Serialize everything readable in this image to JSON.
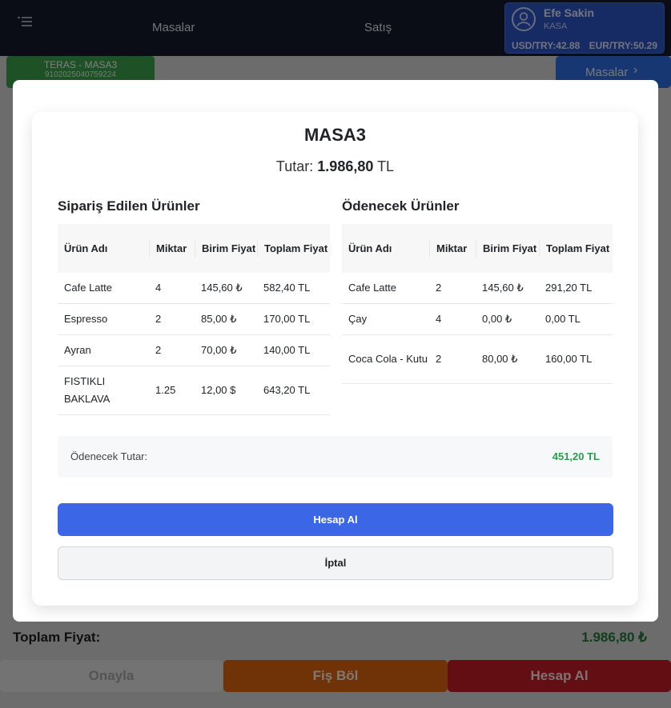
{
  "topbar": {
    "nav": {
      "masalar": "Masalar",
      "satis": "Satış"
    },
    "user": {
      "name": "Efe Sakin",
      "role": "KASA",
      "usd_rate": "USD/TRY:42.88",
      "eur_rate": "EUR/TRY:50.29"
    }
  },
  "active_table": {
    "name": "TERAS - MASA3",
    "code": "9102025040759224"
  },
  "masalar_button": {
    "label": "Masalar",
    "chevron": "›"
  },
  "order_total": {
    "label": "Toplam Fiyat:",
    "value": "1.986,80 ₺"
  },
  "bottom_actions": {
    "onayla": "Onayla",
    "fis_bol": "Fiş Böl",
    "hesap_al": "Hesap Al"
  },
  "modal": {
    "title": "MASA3",
    "total_label": "Tutar:",
    "total_value": "1.986,80",
    "total_currency": "TL",
    "ordered": {
      "title": "Sipariş Edilen Ürünler",
      "headers": [
        "Ürün Adı",
        "Miktar",
        "Birim Fiyat",
        "Toplam Fiyat"
      ],
      "rows": [
        [
          "Cafe Latte",
          "4",
          "145,60 ₺",
          "582,40 TL"
        ],
        [
          "Espresso",
          "2",
          "85,00 ₺",
          "170,00 TL"
        ],
        [
          "Ayran",
          "2",
          "70,00 ₺",
          "140,00 TL"
        ],
        [
          "FISTIKLI BAKLAVA",
          "1.25",
          "12,00 $",
          "643,20 TL"
        ]
      ]
    },
    "to_pay": {
      "title": "Ödenecek Ürünler",
      "headers": [
        "Ürün Adı",
        "Miktar",
        "Birim Fiyat",
        "Toplam Fiyat"
      ],
      "rows": [
        [
          "Cafe Latte",
          "2",
          "145,60 ₺",
          "291,20 TL"
        ],
        [
          "Çay",
          "4",
          "0,00 ₺",
          "0,00 TL"
        ],
        [
          "Coca Cola - Kutu",
          "2",
          "80,00 ₺",
          "160,00 TL"
        ]
      ]
    },
    "summary": {
      "label": "Ödenecek Tutar:",
      "value": "451,20 TL"
    },
    "confirm_label": "Hesap Al",
    "cancel_label": "İptal"
  },
  "colors": {
    "topbar": "#151a2c",
    "user_card": "#2d56c9",
    "table_tab": "#3fa34d",
    "primary": "#3b66e6",
    "success_text": "#2b9d4c",
    "fis_bol": "#e0640f",
    "hesap_al": "#c51d24"
  },
  "icons": {
    "menu": "menu-icon",
    "user": "user-icon",
    "chevron": "chevron-right-icon"
  }
}
